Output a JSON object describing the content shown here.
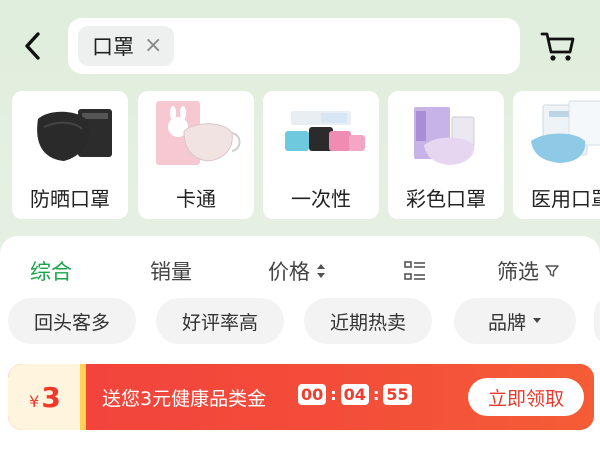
{
  "search": {
    "query": "口罩",
    "clear_icon": "close-icon"
  },
  "categories": [
    {
      "label": "防晒口罩"
    },
    {
      "label": "卡通"
    },
    {
      "label": "一次性"
    },
    {
      "label": "彩色口罩"
    },
    {
      "label": "医用口罩"
    }
  ],
  "sort": {
    "comprehensive": "综合",
    "sales": "销量",
    "price": "价格",
    "filter": "筛选",
    "active_color": "#1aa34a"
  },
  "filters": [
    "回头客多",
    "好评率高",
    "近期热卖",
    "品牌"
  ],
  "banner": {
    "coupon_currency": "¥",
    "coupon_amount": "3",
    "text": "送您3元健康品类金",
    "timer": {
      "h": "00",
      "m": "04",
      "s": "55"
    },
    "claim": "立即领取"
  }
}
